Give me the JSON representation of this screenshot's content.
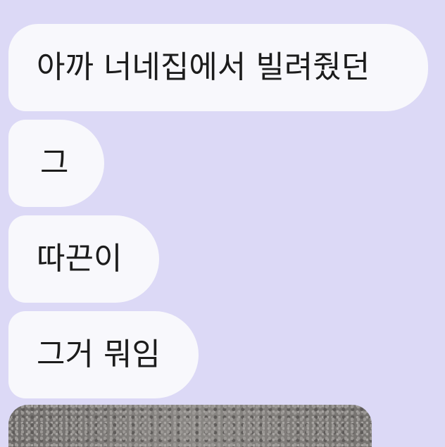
{
  "messages": [
    {
      "text": "아까 너네집에서 빌려줬던"
    },
    {
      "text": "그"
    },
    {
      "text": "따끈이"
    },
    {
      "text": "그거 뭐임"
    }
  ],
  "colors": {
    "chat_background": "#dcd9f6",
    "bubble_background": "#f8f8fc",
    "text": "#1c1c1c"
  }
}
